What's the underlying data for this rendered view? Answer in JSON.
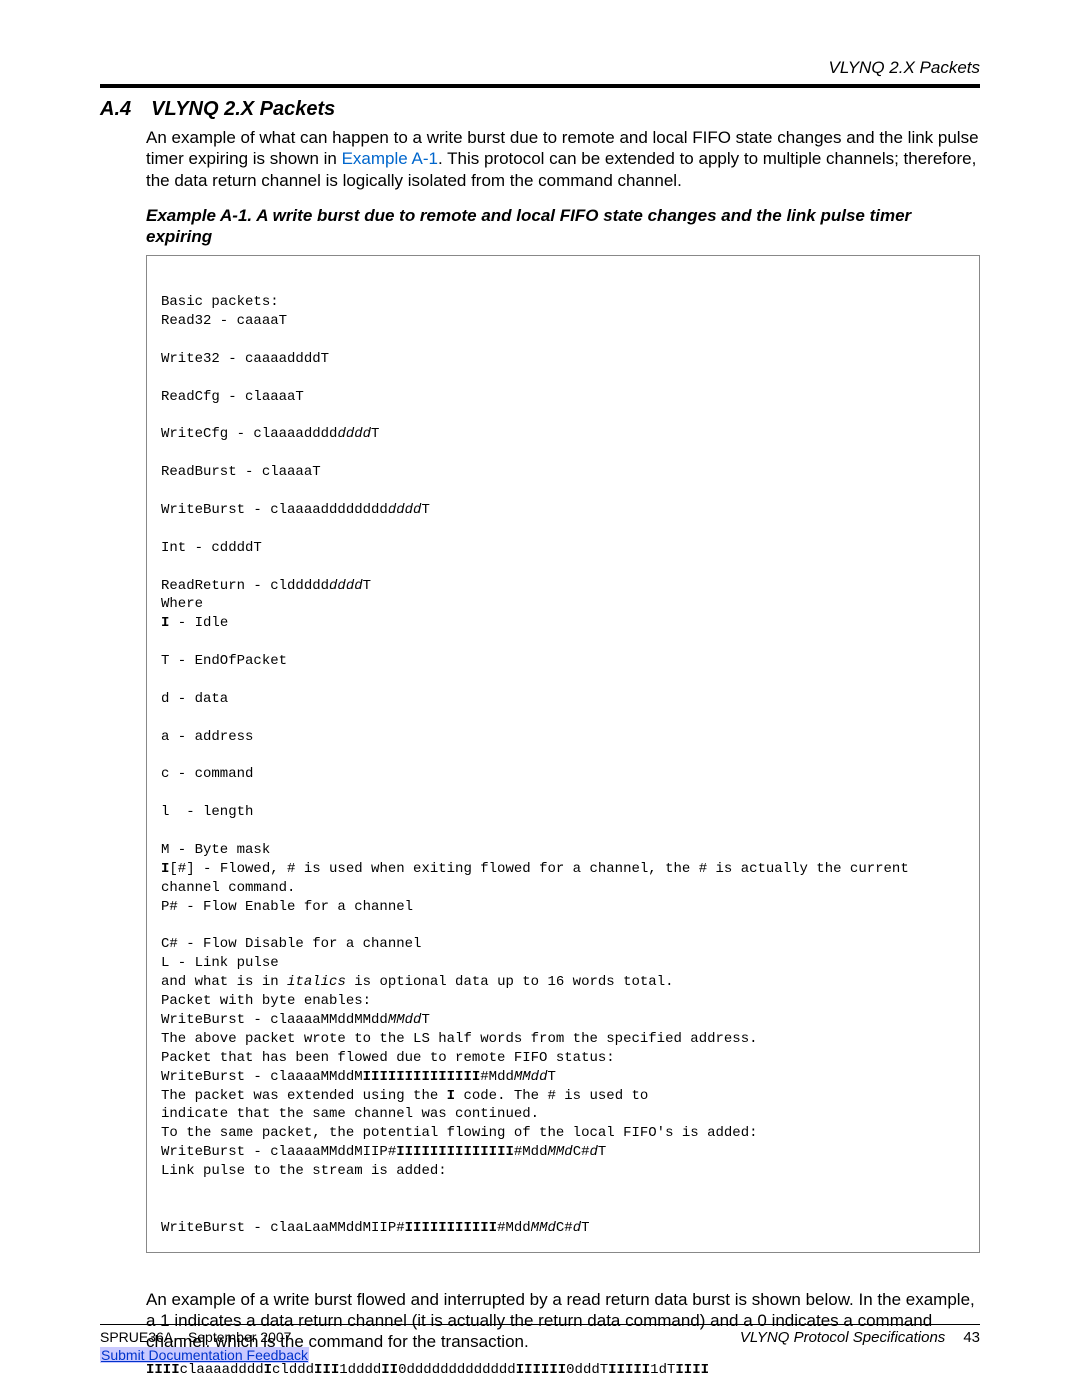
{
  "header": {
    "running": "VLYNQ 2.X Packets"
  },
  "section": {
    "number": "A.4",
    "title": "VLYNQ 2.X Packets"
  },
  "intro": {
    "pre_link": "An example of what can happen to a write burst due to remote and local FIFO state changes and the link pulse timer expiring is shown in ",
    "link_text": "Example A-1",
    "post_link": ". This protocol can be extended to apply to multiple channels; therefore, the data return channel is logically isolated from the command channel."
  },
  "example": {
    "caption": "Example A-1. A write burst due to remote and local FIFO state changes and the link pulse timer expiring"
  },
  "code": {
    "l1": "Basic packets:",
    "l2": "Read32 - caaaaT",
    "l3": "Write32 - caaaaddddT",
    "l4": "ReadCfg - claaaaT",
    "l5a": "WriteCfg - claaaadddd",
    "l5b": "dddd",
    "l5c": "T",
    "l6": "ReadBurst - claaaaT",
    "l7a": "WriteBurst - claaaadddddddd",
    "l7b": "dddd",
    "l7c": "T",
    "l8": "Int - cddddT",
    "l9a": "ReadReturn - clddddd",
    "l9b": "dddd",
    "l9c": "T",
    "l10": "Where",
    "l11a": "I",
    "l11b": " - Idle",
    "l12": "T - EndOfPacket",
    "l13": "d - data",
    "l14": "a - address",
    "l15": "c - command",
    "l16": "l  - length",
    "l17": "M - Byte mask",
    "l18a": "I",
    "l18b": "[#] - Flowed, # is used when exiting flowed for a channel, the # is actually the current",
    "l19": "channel command.",
    "l20": "P# - Flow Enable for a channel",
    "l21": "C# - Flow Disable for a channel",
    "l22": "L - Link pulse",
    "l23a": "and what is in ",
    "l23b": "italics",
    "l23c": " is optional data up to 16 words total.",
    "l24": "Packet with byte enables:",
    "l25a": "WriteBurst - claaaaMMddMMdd",
    "l25b": "MMdd",
    "l25c": "T",
    "l26": "The above packet wrote to the LS half words from the specified address.",
    "l27": "Packet that has been flowed due to remote FIFO status:",
    "l28a": "WriteBurst - claaaaMMddM",
    "l28b": "IIIIIIIIIIIIII",
    "l28c": "#Mdd",
    "l28d": "MMdd",
    "l28e": "T",
    "l29a": "The packet was extended using the ",
    "l29b": "I",
    "l29c": " code. The # is used to",
    "l30": "indicate that the same channel was continued.",
    "l31": "To the same packet, the potential flowing of the local FIFO's is added:",
    "l32a": "WriteBurst - claaaaMMddMIIP#",
    "l32b": "IIIIIIIIIIIIII",
    "l32c": "#Mdd",
    "l32d": "MMd",
    "l32e": "C#",
    "l32f": "d",
    "l32g": "T",
    "l33": "Link pulse to the stream is added:",
    "l34a": "WriteBurst - claaLaaMMddMIIP#",
    "l34b": "IIIIIIIIIII",
    "l34c": "#Mdd",
    "l34d": "MMd",
    "l34e": "C#",
    "l34f": "d",
    "l34g": "T"
  },
  "outro": {
    "text": "An example of a write burst flowed and interrupted by a read return data burst is shown below. In the example, a 1 indicates a data return channel (it is actually the return data command) and a 0 indicates a command channel, which is the command for the transaction."
  },
  "mono": {
    "p1": "IIII",
    "p2": "claaaadddd",
    "p3": "I",
    "p4": "clddd",
    "p5": "III",
    "p6": "1dddd",
    "p7": "II",
    "p8": "0ddddddddddddd",
    "p9": "IIIIII",
    "p10": "0dddT",
    "p11": "IIIII",
    "p12": "1dT",
    "p13": "IIII"
  },
  "footer": {
    "left": "SPRUE36A – September 2007",
    "right_title": "VLYNQ Protocol Specifications",
    "page": "43",
    "link": "Submit Documentation Feedback"
  }
}
